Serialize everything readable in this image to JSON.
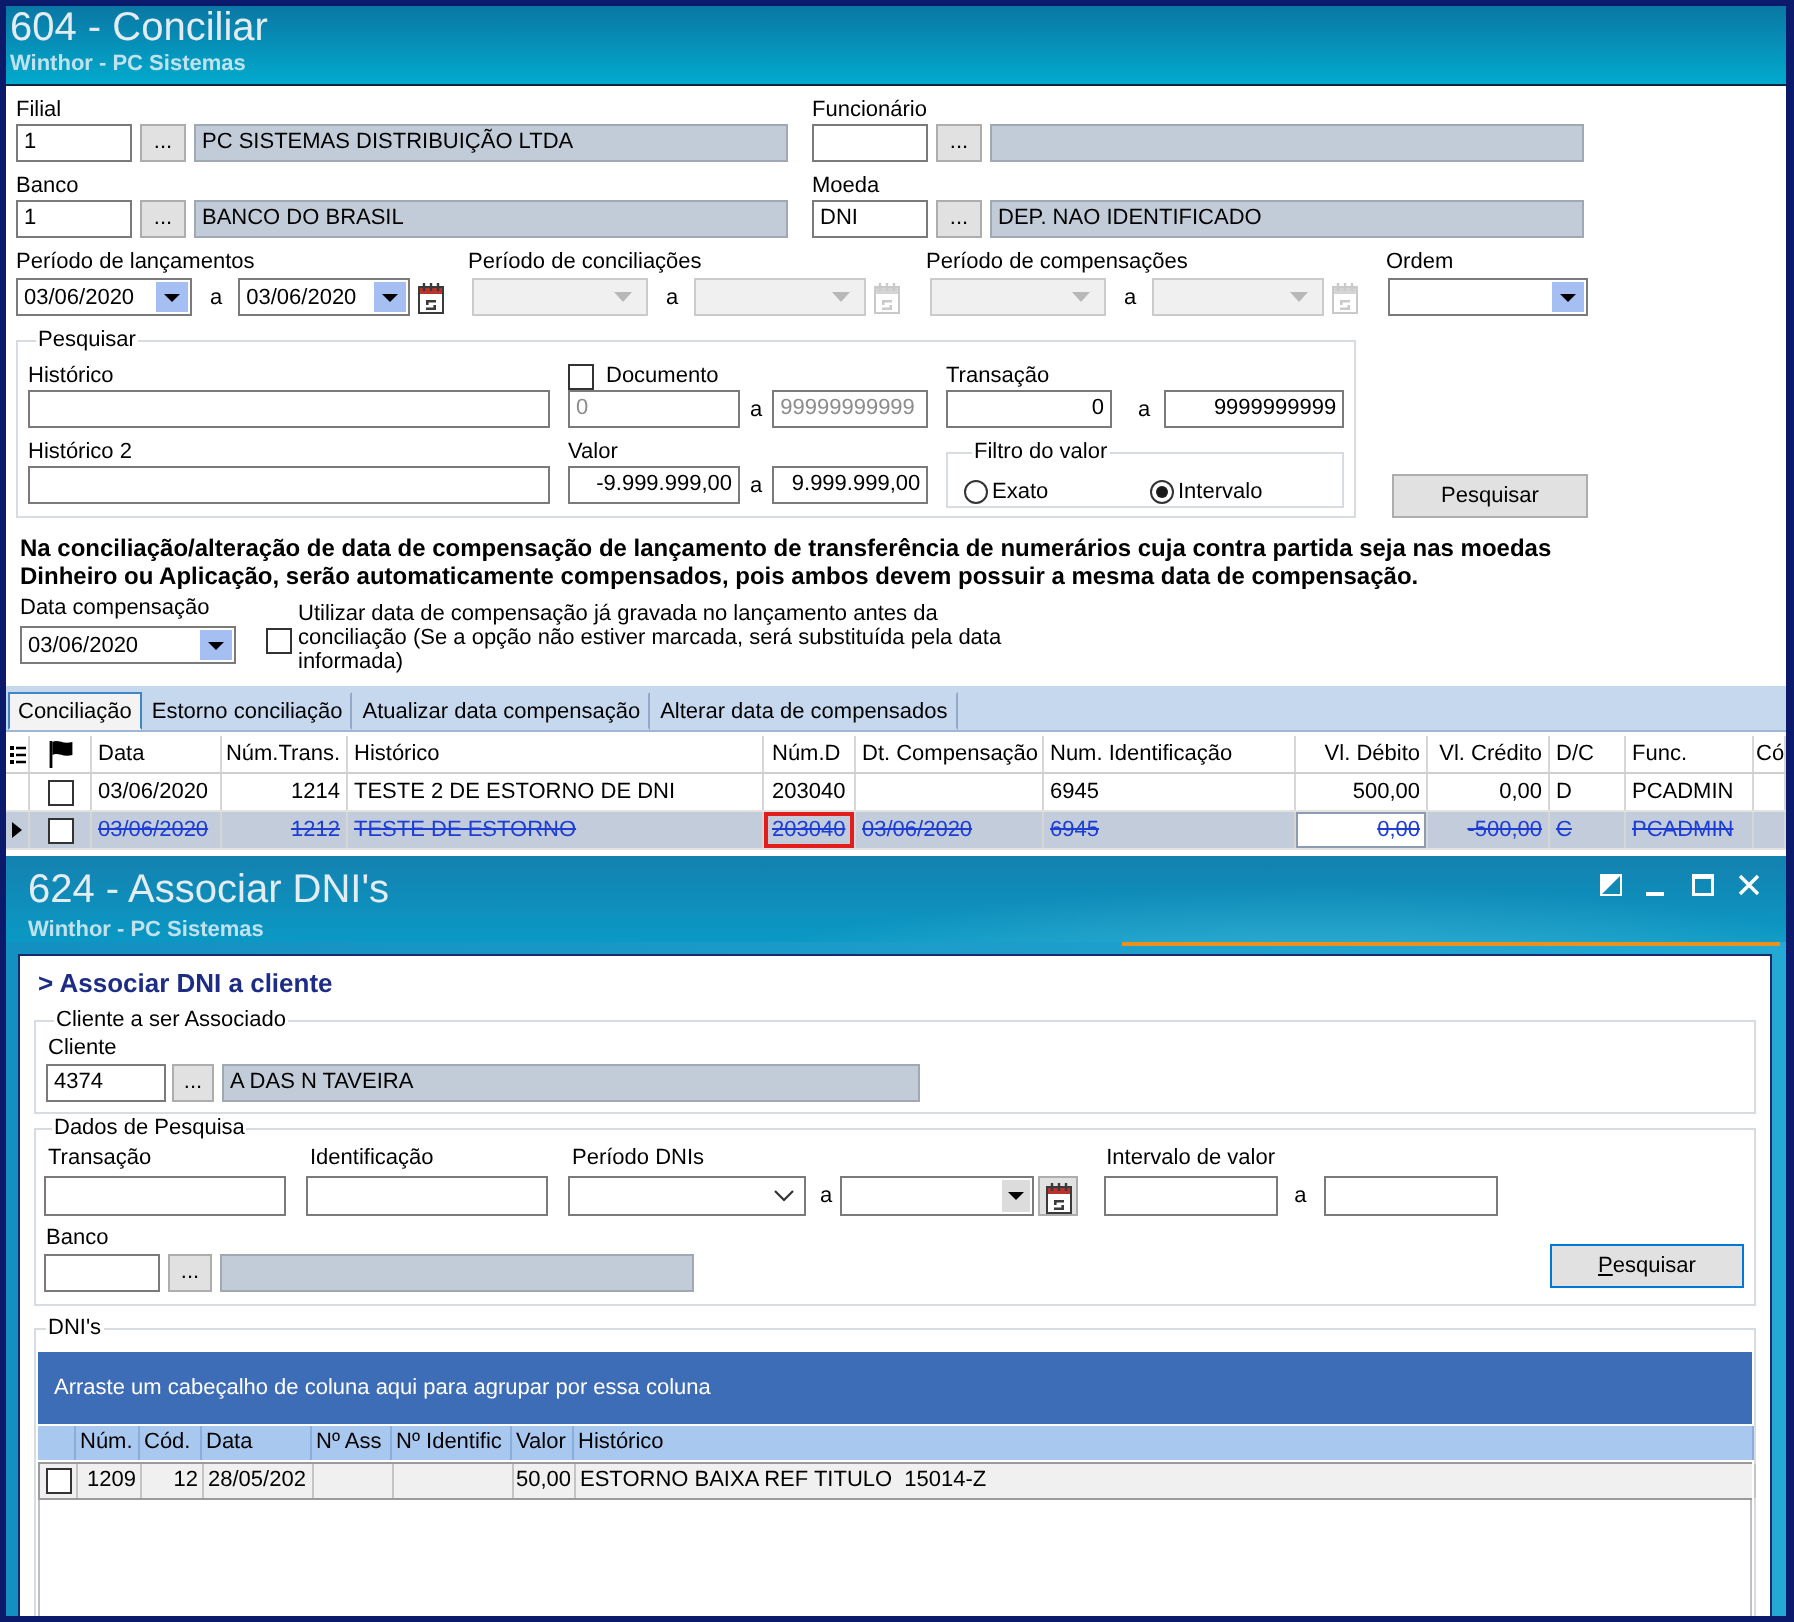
{
  "window": {
    "title": "604 - Conciliar",
    "subtitle": "Winthor - PC Sistemas"
  },
  "lookups": [
    {
      "label": "Filial",
      "value": "1",
      "button": "...",
      "description": "PC SISTEMAS DISTRIBUIÇÃO LTDA"
    },
    {
      "label": "Funcionário",
      "button": "..."
    },
    {
      "label": "Banco",
      "value": "1",
      "button": "...",
      "description": "BANCO DO BRASIL"
    },
    {
      "label": "Moeda",
      "value": "DNI",
      "button": "...",
      "description": "DEP. NAO IDENTIFICADO"
    }
  ],
  "periods": [
    {
      "label": "Período de lançamentos",
      "from": "03/06/2020",
      "separator": "a",
      "to": "03/06/2020",
      "disabled": false
    },
    {
      "label": "Período de conciliações",
      "separator": "a",
      "disabled": true
    },
    {
      "label": "Período de compensações",
      "separator": "a",
      "disabled": true
    }
  ],
  "order": {
    "label": "Ordem"
  },
  "search": {
    "title": "Pesquisar",
    "history": {
      "label": "Histórico"
    },
    "document": {
      "label": "Documento",
      "checked": false,
      "from": "0",
      "separator": "a",
      "to": "99999999999"
    },
    "transaction": {
      "label": "Transação",
      "from": "0",
      "separator": "a",
      "to": "9999999999"
    },
    "history_2": {
      "label": "Histórico 2"
    },
    "value": {
      "label": "Valor",
      "from": "-9.999.999,00",
      "separator": "a",
      "to": "9.999.999,00"
    },
    "value_filter": {
      "title": "Filtro do valor",
      "options": [
        {
          "label": "Exato",
          "selected": false
        },
        {
          "label": "Intervalo",
          "selected": true
        }
      ]
    },
    "button": "Pesquisar"
  },
  "notice": "Na conciliação/alteração de data de compensação de lançamento de transferência de numerários cuja contra partida seja nas moedas Dinheiro ou Aplicação, serão automaticamente compensados, pois ambos devem possuir a mesma data de compensação.",
  "compensation": {
    "label": "Data compensação",
    "value": "03/06/2020",
    "option": {
      "label": "Utilizar data de compensação já gravada no lançamento antes da conciliação (Se a opção não estiver marcada, será substituída pela data informada)",
      "checked": false
    }
  },
  "tabs": [
    {
      "label": "Conciliação",
      "selected": true
    },
    {
      "label": "Estorno conciliação",
      "selected": false
    },
    {
      "label": "Atualizar data compensação",
      "selected": false
    },
    {
      "label": "Alterar data de compensados",
      "selected": false
    }
  ],
  "grid": {
    "columns": [
      {
        "label": "Data",
        "kind": "text"
      },
      {
        "label": "Núm.Trans.",
        "kind": "number"
      },
      {
        "label": "Histórico",
        "kind": "text"
      },
      {
        "label": "Núm.D",
        "kind": "text"
      },
      {
        "label": "Dt. Compensação",
        "kind": "text"
      },
      {
        "label": "Num. Identificação",
        "kind": "text"
      },
      {
        "label": "Vl. Débito",
        "kind": "number"
      },
      {
        "label": "Vl. Crédito",
        "kind": "number"
      },
      {
        "label": "D/C",
        "kind": "text"
      },
      {
        "label": "Func.",
        "kind": "text"
      },
      {
        "label": "Có",
        "kind": "text"
      }
    ],
    "rows": [
      {
        "current": false,
        "selected": false,
        "checked": false,
        "cancelled": false,
        "cells": [
          {
            "text": "03/06/2020",
            "focused": false,
            "outlined": false
          },
          {
            "text": "1214",
            "focused": false,
            "outlined": false
          },
          {
            "text": "TESTE 2 DE ESTORNO DE DNI",
            "focused": false,
            "outlined": false
          },
          {
            "text": "203040",
            "focused": false,
            "outlined": false
          },
          {
            "focused": false,
            "outlined": false
          },
          {
            "text": "6945",
            "focused": false,
            "outlined": false
          },
          {
            "text": "500,00",
            "focused": false,
            "outlined": false
          },
          {
            "text": "0,00",
            "focused": false,
            "outlined": false
          },
          {
            "text": "D",
            "focused": false,
            "outlined": false
          },
          {
            "text": "PCADMIN",
            "focused": false,
            "outlined": false
          },
          {
            "focused": false,
            "outlined": false
          }
        ]
      },
      {
        "current": true,
        "selected": true,
        "checked": false,
        "cancelled": true,
        "cells": [
          {
            "text": "03/06/2020",
            "focused": false,
            "outlined": false
          },
          {
            "text": "1212",
            "focused": false,
            "outlined": false
          },
          {
            "text": "TESTE DE ESTORNO",
            "focused": false,
            "outlined": false
          },
          {
            "text": "203040",
            "focused": false,
            "outlined": true
          },
          {
            "text": "03/06/2020",
            "focused": false,
            "outlined": false
          },
          {
            "text": "6945",
            "focused": false,
            "outlined": false
          },
          {
            "text": "0,00",
            "focused": true,
            "outlined": false
          },
          {
            "text": "-500,00",
            "focused": false,
            "outlined": false
          },
          {
            "text": "C",
            "focused": false,
            "outlined": false
          },
          {
            "text": "PCADMIN",
            "focused": false,
            "outlined": false
          },
          {
            "focused": false,
            "outlined": false
          }
        ]
      }
    ]
  },
  "dialog": {
    "title": "624 - Associar DNI's",
    "subtitle": "Winthor - PC Sistemas",
    "heading": "> Associar DNI a cliente",
    "client": {
      "title": "Cliente a ser Associado",
      "label": "Cliente",
      "value": "4374",
      "button": "...",
      "description": "A DAS N TAVEIRA"
    },
    "filters": {
      "title": "Dados de Pesquisa",
      "transaction": {
        "label": "Transação"
      },
      "identification": {
        "label": "Identificação"
      },
      "period": {
        "label": "Período DNIs",
        "separator": "a"
      },
      "value_range": {
        "label": "Intervalo de valor",
        "separator": "a"
      },
      "bank": {
        "label": "Banco",
        "button": "..."
      },
      "button": "Pesquisar"
    },
    "results": {
      "title": "DNI's",
      "group_hint": "Arraste um cabeçalho de coluna aqui para agrupar por essa coluna",
      "columns": [
        {
          "label": "Núm.",
          "kind": "number"
        },
        {
          "label": "Cód.",
          "kind": "number"
        },
        {
          "label": "Data",
          "kind": "text"
        },
        {
          "label": "Nº Ass",
          "kind": "text"
        },
        {
          "label": "Nº Identific",
          "kind": "text"
        },
        {
          "label": "Valor",
          "kind": "number"
        },
        {
          "label": "Histórico",
          "kind": "text"
        }
      ],
      "rows": [
        {
          "checked": false,
          "cells": [
            {
              "text": "1209"
            },
            {
              "text": "12"
            },
            {
              "text": "28/05/202"
            },
            null,
            null,
            {
              "text": "50,00"
            },
            {
              "text": "ESTORNO BAIXA REF TITULO  15014-Z"
            }
          ]
        }
      ]
    }
  }
}
